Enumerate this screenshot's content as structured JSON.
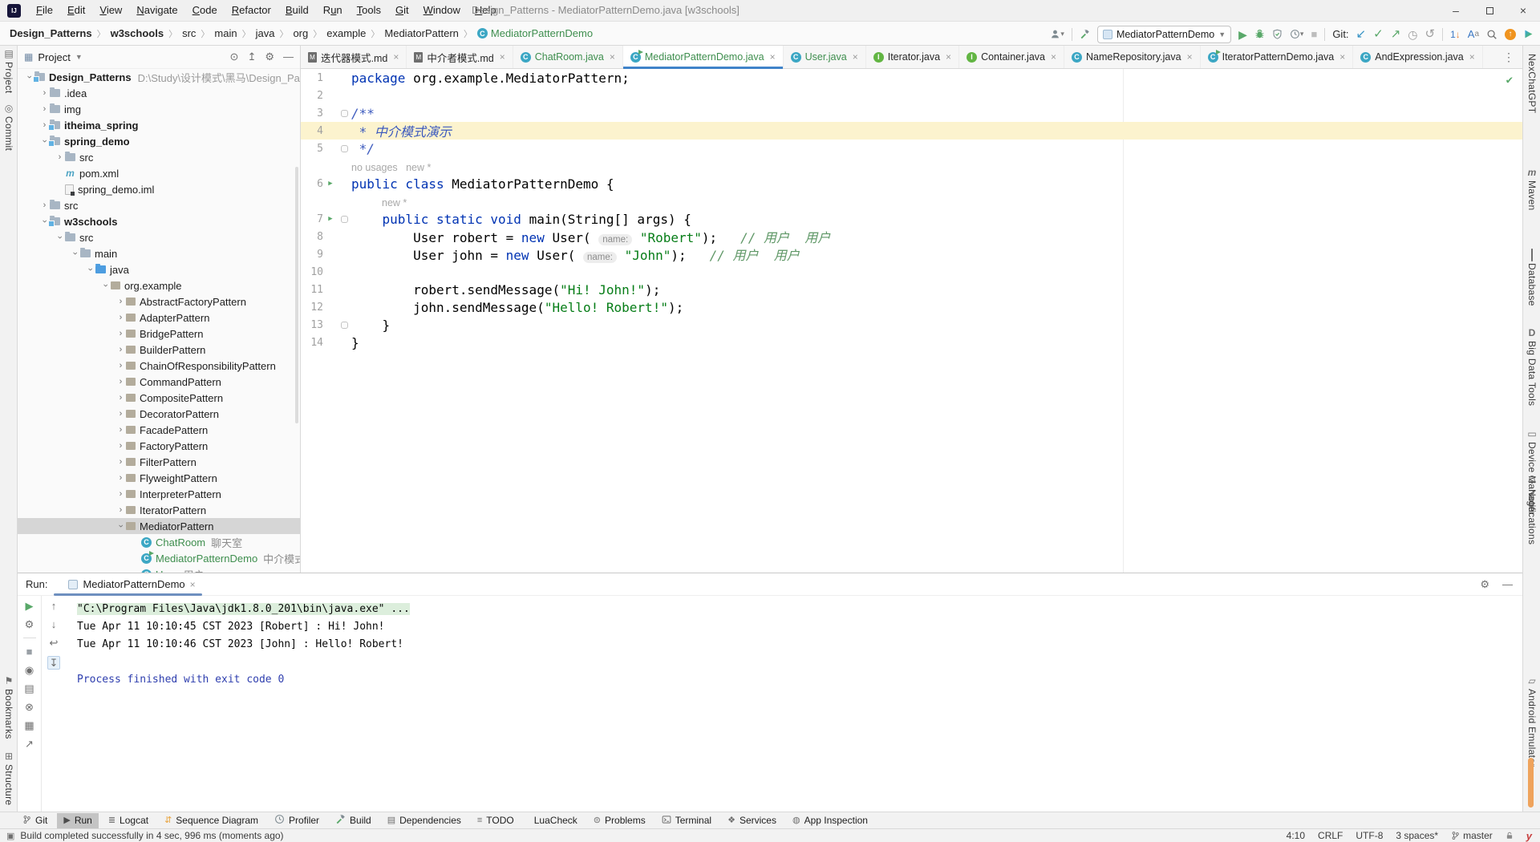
{
  "window": {
    "title": "Design_Patterns - MediatorPatternDemo.java [w3schools]"
  },
  "menu": {
    "items": [
      {
        "label": "File",
        "mn": 0
      },
      {
        "label": "Edit",
        "mn": 0
      },
      {
        "label": "View",
        "mn": 0
      },
      {
        "label": "Navigate",
        "mn": 0
      },
      {
        "label": "Code",
        "mn": 0
      },
      {
        "label": "Refactor",
        "mn": 0
      },
      {
        "label": "Build",
        "mn": 0
      },
      {
        "label": "Run",
        "mn": 1
      },
      {
        "label": "Tools",
        "mn": 0
      },
      {
        "label": "Git",
        "mn": 0
      },
      {
        "label": "Window",
        "mn": 0
      },
      {
        "label": "Help",
        "mn": 0
      }
    ]
  },
  "toolbar": {
    "breadcrumbs": [
      {
        "label": "Design_Patterns",
        "bold": true
      },
      {
        "label": "w3schools",
        "bold": true
      },
      {
        "label": "src"
      },
      {
        "label": "main"
      },
      {
        "label": "java"
      },
      {
        "label": "org"
      },
      {
        "label": "example"
      },
      {
        "label": "MediatorPattern"
      },
      {
        "label": "MediatorPatternDemo",
        "icon": "class",
        "last": true
      }
    ],
    "run_config": "MediatorPatternDemo",
    "git_label": "Git:"
  },
  "left_stripe": {
    "top": [
      {
        "label": "Project",
        "icon": "project"
      },
      {
        "label": "Commit",
        "icon": "commit"
      }
    ],
    "bottom": [
      {
        "label": "Bookmarks",
        "icon": "bookmarks"
      },
      {
        "label": "Structure",
        "icon": "structure"
      }
    ]
  },
  "right_stripe": {
    "items": [
      {
        "label": "NexChatGPT",
        "icon": ""
      },
      {
        "label": "Maven",
        "icon": "maven-letter"
      },
      {
        "label": "Database",
        "icon": "database"
      },
      {
        "label": "Big Data Tools",
        "icon": "bigdata"
      },
      {
        "label": "Device Manager",
        "icon": "device"
      },
      {
        "label": "Notifications",
        "icon": "bell"
      },
      {
        "label": "Android Emulator",
        "icon": "emulator"
      }
    ]
  },
  "project_panel": {
    "title": "Project",
    "tree": [
      {
        "d": 0,
        "chev": "v",
        "icon": "module",
        "label": "Design_Patterns",
        "bold": true,
        "path": "D:\\Study\\设计模式\\黑马\\Design_Patte"
      },
      {
        "d": 1,
        "chev": ">",
        "icon": "folder",
        "label": ".idea"
      },
      {
        "d": 1,
        "chev": ">",
        "icon": "folder",
        "label": "img"
      },
      {
        "d": 1,
        "chev": ">",
        "icon": "module",
        "label": "itheima_spring",
        "bold": true
      },
      {
        "d": 1,
        "chev": "v",
        "icon": "module",
        "label": "spring_demo",
        "bold": true
      },
      {
        "d": 2,
        "chev": ">",
        "icon": "folder",
        "label": "src"
      },
      {
        "d": 2,
        "chev": "",
        "icon": "maven",
        "label": "pom.xml"
      },
      {
        "d": 2,
        "chev": "",
        "icon": "iml",
        "label": "spring_demo.iml"
      },
      {
        "d": 1,
        "chev": ">",
        "icon": "folder",
        "label": "src"
      },
      {
        "d": 1,
        "chev": "v",
        "icon": "module",
        "label": "w3schools",
        "bold": true
      },
      {
        "d": 2,
        "chev": "v",
        "icon": "folder",
        "label": "src"
      },
      {
        "d": 3,
        "chev": "v",
        "icon": "folder",
        "label": "main"
      },
      {
        "d": 4,
        "chev": "v",
        "icon": "srcroot",
        "label": "java"
      },
      {
        "d": 5,
        "chev": "v",
        "icon": "package",
        "label": "org.example"
      },
      {
        "d": 6,
        "chev": ">",
        "icon": "package",
        "label": "AbstractFactoryPattern"
      },
      {
        "d": 6,
        "chev": ">",
        "icon": "package",
        "label": "AdapterPattern"
      },
      {
        "d": 6,
        "chev": ">",
        "icon": "package",
        "label": "BridgePattern"
      },
      {
        "d": 6,
        "chev": ">",
        "icon": "package",
        "label": "BuilderPattern"
      },
      {
        "d": 6,
        "chev": ">",
        "icon": "package",
        "label": "ChainOfResponsibilityPattern"
      },
      {
        "d": 6,
        "chev": ">",
        "icon": "package",
        "label": "CommandPattern"
      },
      {
        "d": 6,
        "chev": ">",
        "icon": "package",
        "label": "CompositePattern"
      },
      {
        "d": 6,
        "chev": ">",
        "icon": "package",
        "label": "DecoratorPattern"
      },
      {
        "d": 6,
        "chev": ">",
        "icon": "package",
        "label": "FacadePattern"
      },
      {
        "d": 6,
        "chev": ">",
        "icon": "package",
        "label": "FactoryPattern"
      },
      {
        "d": 6,
        "chev": ">",
        "icon": "package",
        "label": "FilterPattern"
      },
      {
        "d": 6,
        "chev": ">",
        "icon": "package",
        "label": "FlyweightPattern"
      },
      {
        "d": 6,
        "chev": ">",
        "icon": "package",
        "label": "InterpreterPattern"
      },
      {
        "d": 6,
        "chev": ">",
        "icon": "package",
        "label": "IteratorPattern"
      },
      {
        "d": 6,
        "chev": "v",
        "icon": "package",
        "label": "MediatorPattern",
        "selected": true
      },
      {
        "d": 7,
        "chev": "",
        "icon": "class",
        "label": "ChatRoom",
        "green": true,
        "suffix": "聊天室"
      },
      {
        "d": 7,
        "chev": "",
        "icon": "class-run",
        "label": "MediatorPatternDemo",
        "green": true,
        "suffix": "中介模式演示"
      },
      {
        "d": 7,
        "chev": "",
        "icon": "class",
        "label": "User",
        "green": true,
        "suffix": "用户"
      }
    ]
  },
  "tabs": [
    {
      "label": "迭代器模式.md",
      "icon": "md"
    },
    {
      "label": "中介者模式.md",
      "icon": "md"
    },
    {
      "label": "ChatRoom.java",
      "icon": "class",
      "green": true
    },
    {
      "label": "MediatorPatternDemo.java",
      "icon": "class-run",
      "green": true,
      "active": true
    },
    {
      "label": "User.java",
      "icon": "class",
      "green": true
    },
    {
      "label": "Iterator.java",
      "icon": "interface"
    },
    {
      "label": "Container.java",
      "icon": "interface"
    },
    {
      "label": "NameRepository.java",
      "icon": "class"
    },
    {
      "label": "IteratorPatternDemo.java",
      "icon": "class-run"
    },
    {
      "label": "AndExpression.java",
      "icon": "class"
    }
  ],
  "editor": {
    "lines": [
      {
        "n": "1",
        "seg": [
          [
            "kw",
            "package "
          ],
          [
            "pl",
            "org.example.MediatorPattern;"
          ]
        ]
      },
      {
        "n": "2",
        "seg": []
      },
      {
        "n": "3",
        "seg": [
          [
            "doc",
            "/**"
          ]
        ],
        "fold": true
      },
      {
        "n": "4",
        "seg": [
          [
            "doc",
            " * 中介模式演示"
          ]
        ],
        "cur": true
      },
      {
        "n": "5",
        "seg": [
          [
            "doc",
            " */"
          ]
        ],
        "fold": true
      },
      {
        "n": "",
        "seg": [
          [
            "inlay",
            "no usages   new *"
          ]
        ],
        "ind": 0
      },
      {
        "n": "6",
        "seg": [
          [
            "kw",
            "public class "
          ],
          [
            "pl",
            "MediatorPatternDemo {"
          ]
        ],
        "run": true
      },
      {
        "n": "",
        "seg": [
          [
            "inlay",
            "new *"
          ]
        ],
        "ind": 1
      },
      {
        "n": "7",
        "seg": [
          [
            "pl",
            "    "
          ],
          [
            "kw",
            "public static void "
          ],
          [
            "pl",
            "main(String[] args) {"
          ]
        ],
        "run": true,
        "fold": true
      },
      {
        "n": "8",
        "seg": [
          [
            "pl",
            "        User robert = "
          ],
          [
            "kw",
            "new "
          ],
          [
            "pl",
            "User( "
          ],
          [
            "hint",
            "name:"
          ],
          [
            "pl",
            " "
          ],
          [
            "str",
            "\"Robert\""
          ],
          [
            "pl",
            ");   "
          ],
          [
            "cmt",
            "// 用户  用户"
          ]
        ]
      },
      {
        "n": "9",
        "seg": [
          [
            "pl",
            "        User john = "
          ],
          [
            "kw",
            "new "
          ],
          [
            "pl",
            "User( "
          ],
          [
            "hint",
            "name:"
          ],
          [
            "pl",
            " "
          ],
          [
            "str",
            "\"John\""
          ],
          [
            "pl",
            ");   "
          ],
          [
            "cmt",
            "// 用户  用户"
          ]
        ]
      },
      {
        "n": "10",
        "seg": []
      },
      {
        "n": "11",
        "seg": [
          [
            "pl",
            "        robert.sendMessage("
          ],
          [
            "str",
            "\"Hi! John!\""
          ],
          [
            "pl",
            ");"
          ]
        ]
      },
      {
        "n": "12",
        "seg": [
          [
            "pl",
            "        john.sendMessage("
          ],
          [
            "str",
            "\"Hello! Robert!\""
          ],
          [
            "pl",
            ");"
          ]
        ]
      },
      {
        "n": "13",
        "seg": [
          [
            "pl",
            "    }"
          ]
        ],
        "fold": true
      },
      {
        "n": "14",
        "seg": [
          [
            "pl",
            "}"
          ]
        ]
      }
    ]
  },
  "run_panel": {
    "label": "Run:",
    "tab": "MediatorPatternDemo",
    "console": [
      {
        "text": "\"C:\\Program Files\\Java\\jdk1.8.0_201\\bin\\java.exe\" ...",
        "hl": true
      },
      {
        "text": "Tue Apr 11 10:10:45 CST 2023 [Robert] : Hi! John!"
      },
      {
        "text": "Tue Apr 11 10:10:46 CST 2023 [John] : Hello! Robert!"
      },
      {
        "text": ""
      },
      {
        "text": "Process finished with exit code 0",
        "sys": true
      }
    ]
  },
  "bottom_bar": [
    {
      "label": "Git",
      "icon": "branch"
    },
    {
      "label": "Run",
      "icon": "run-tri",
      "active": true
    },
    {
      "label": "Logcat",
      "icon": "logcat"
    },
    {
      "label": "Sequence Diagram",
      "icon": "sequence"
    },
    {
      "label": "Profiler",
      "icon": "profiler"
    },
    {
      "label": "Build",
      "icon": "hammer"
    },
    {
      "label": "Dependencies",
      "icon": "dependencies"
    },
    {
      "label": "TODO",
      "icon": "todo"
    },
    {
      "label": "LuaCheck",
      "icon": "luacheck"
    },
    {
      "label": "Problems",
      "icon": "problems"
    },
    {
      "label": "Terminal",
      "icon": "terminal"
    },
    {
      "label": "Services",
      "icon": "services"
    },
    {
      "label": "App Inspection",
      "icon": "app-inspection"
    }
  ],
  "status_bar": {
    "left": "Build completed successfully in 4 sec, 996 ms (moments ago)",
    "caret": "4:10",
    "line_ending": "CRLF",
    "encoding": "UTF-8",
    "indent": "3 spaces*",
    "branch": "master"
  },
  "colors": {
    "accent_tab": "#4083C9",
    "run_green": "#59A869",
    "added_green": "#3E8E4E",
    "caret_row": "#FCF3CE"
  }
}
